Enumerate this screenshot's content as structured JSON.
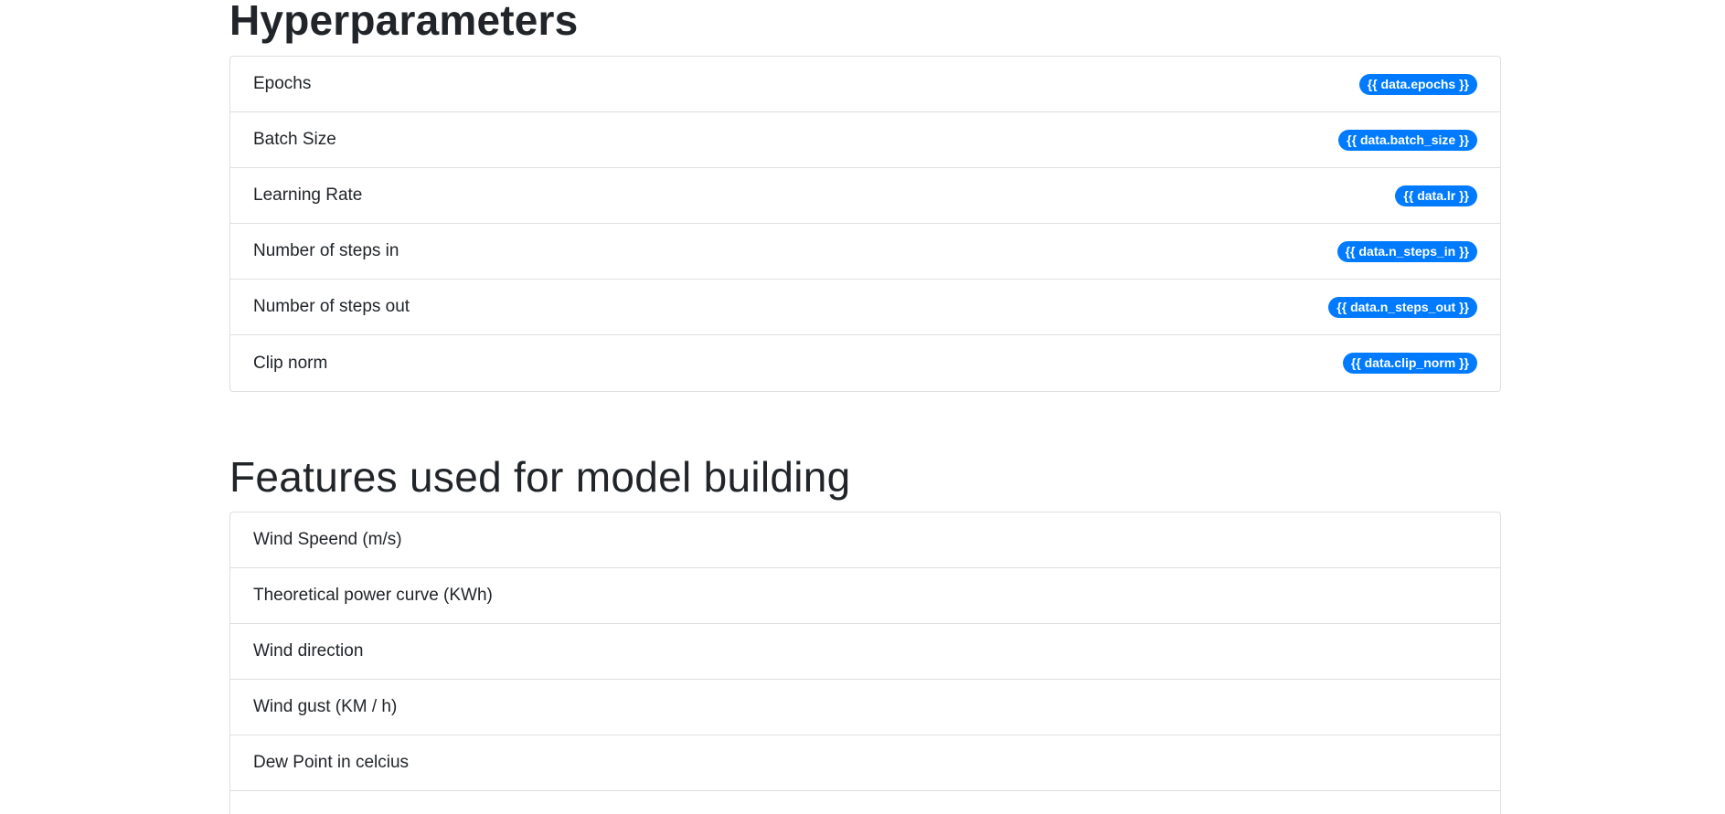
{
  "hyperparameters": {
    "title": "Hyperparameters",
    "items": [
      {
        "label": "Epochs",
        "value": "{{ data.epochs }}"
      },
      {
        "label": "Batch Size",
        "value": "{{ data.batch_size }}"
      },
      {
        "label": "Learning Rate",
        "value": "{{ data.lr }}"
      },
      {
        "label": "Number of steps in",
        "value": "{{ data.n_steps_in }}"
      },
      {
        "label": "Number of steps out",
        "value": "{{ data.n_steps_out }}"
      },
      {
        "label": "Clip norm",
        "value": "{{ data.clip_norm }}"
      }
    ]
  },
  "features": {
    "title": "Features used for model building",
    "items": [
      {
        "label": "Wind Speend (m/s)"
      },
      {
        "label": "Theoretical power curve (KWh)"
      },
      {
        "label": "Wind direction"
      },
      {
        "label": "Wind gust (KM / h)"
      },
      {
        "label": "Dew Point in celcius"
      }
    ]
  },
  "colors": {
    "badge": "#007bff",
    "text": "#212529",
    "border": "#dfdfdf"
  }
}
